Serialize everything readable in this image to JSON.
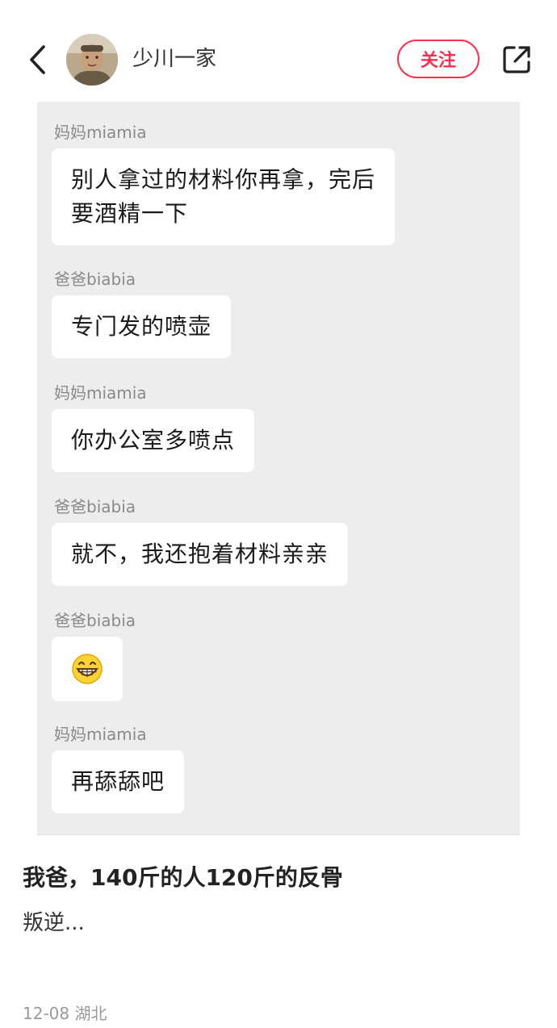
{
  "header": {
    "author_name": "少川一家",
    "follow_label": "关注"
  },
  "chat": {
    "messages": [
      {
        "sender": "妈妈miamia",
        "text": "别人拿过的材料你再拿，完后\n要酒精一下"
      },
      {
        "sender": "爸爸biabia",
        "text": "专门发的喷壶"
      },
      {
        "sender": "妈妈miamia",
        "text": "你办公室多喷点"
      },
      {
        "sender": "爸爸biabia",
        "text": "就不，我还抱着材料亲亲"
      },
      {
        "sender": "爸爸biabia",
        "emoji": "grinning-face-emoji"
      },
      {
        "sender": "妈妈miamia",
        "text": "再舔舔吧"
      }
    ]
  },
  "post": {
    "title": "我爸，140斤的人120斤的反骨",
    "body": "叛逆...",
    "date": "12-08",
    "location": "湖北"
  },
  "colors": {
    "accent": "#ff2e4d",
    "chat_bg": "#ededed",
    "bubble_bg": "#ffffff"
  }
}
